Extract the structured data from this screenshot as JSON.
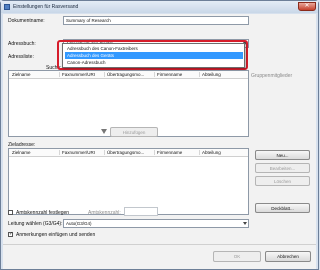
{
  "window": {
    "title": "Einstellungen für Rasversand",
    "close_glyph": "✕"
  },
  "document": {
    "label": "Dokumentname:",
    "value": "Summary of Research"
  },
  "address_book": {
    "label": "Adressbuch:",
    "selected": "Adressbuch des Geräts",
    "options": [
      "Adressbuch des Canon-Faxtreibers",
      "Adressbuch des Geräts",
      "Canon-Adressbuch"
    ],
    "selected_index": 1
  },
  "addresses_label": "Adressliste:",
  "search_label": "Suche:",
  "search_button": "Suchen",
  "group_members_label": "Gruppenmitglieder",
  "list_columns": [
    "Zielname",
    "Faxnummer/URI",
    "Übertragungsmo...",
    "Firmenname",
    "Abteilung"
  ],
  "add_button": "Hinzufügen",
  "destination": {
    "label": "Zieladresse:",
    "columns": [
      "Zielname",
      "Faxnummer/URI",
      "Übertragungsmo...",
      "Firmenname",
      "Abteilung"
    ]
  },
  "side_buttons": {
    "new": "Neu...",
    "edit": "Bearbeiten...",
    "delete": "Löschen",
    "print_list": "Deckblatt..."
  },
  "outside_line": {
    "label": "Amtskennzahl festlegen",
    "field_label": "Amtskennzahl:",
    "value": "",
    "checked": false
  },
  "line": {
    "label": "Leitung wählen (G3/G4):",
    "value": "Auto(G3/G4)"
  },
  "notes": {
    "label": "Anmerkungen einfügen und senden",
    "checked": true
  },
  "footer": {
    "ok": "OK",
    "cancel": "Abbrechen"
  }
}
